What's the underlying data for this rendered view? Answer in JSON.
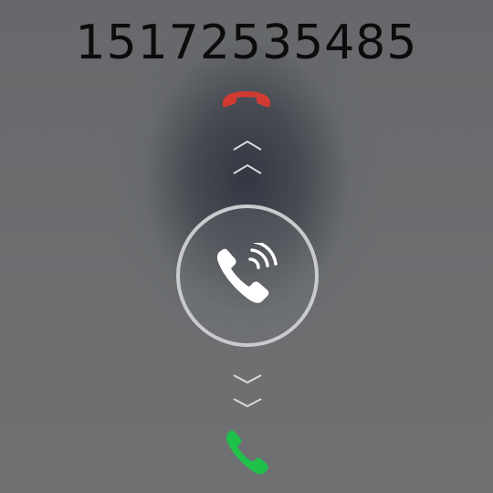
{
  "call": {
    "caller_number": "15172535485"
  },
  "colors": {
    "decline": "#d23a34",
    "accept": "#1fc14b",
    "ring": "#c9cacd",
    "chevron": "#d8d9db",
    "phone_glyph": "#ffffff"
  },
  "icons": {
    "decline": "phone-hangup-icon",
    "answer": "phone-ringing-icon",
    "accept": "phone-accept-icon",
    "up_chevrons": "chevron-up-icon",
    "down_chevrons": "chevron-down-icon"
  }
}
